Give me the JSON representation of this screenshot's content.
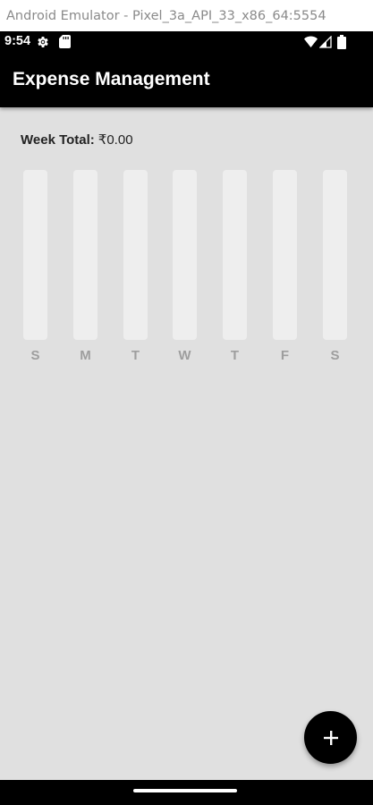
{
  "window": {
    "title": "Android Emulator - Pixel_3a_API_33_x86_64:5554"
  },
  "status_bar": {
    "time": "9:54",
    "left_icons": [
      "settings-gear-icon",
      "sd-card-icon"
    ],
    "right_icons": [
      "wifi-icon",
      "cell-signal-icon",
      "battery-icon"
    ]
  },
  "app_bar": {
    "title": "Expense Management"
  },
  "summary": {
    "label": "Week Total:",
    "value": "₹0.00"
  },
  "chart": {
    "days": [
      {
        "label": "S",
        "fraction": 0
      },
      {
        "label": "M",
        "fraction": 0
      },
      {
        "label": "T",
        "fraction": 0
      },
      {
        "label": "W",
        "fraction": 0
      },
      {
        "label": "T",
        "fraction": 0
      },
      {
        "label": "F",
        "fraction": 0
      },
      {
        "label": "S",
        "fraction": 0
      }
    ]
  },
  "fab": {
    "icon": "plus-icon"
  },
  "colors": {
    "app_bar": "#000000",
    "background": "#e0e0e0",
    "bar_track": "#eeeeee",
    "bar_fill": "#000000",
    "day_label": "#9e9e9e",
    "fab": "#000000"
  }
}
